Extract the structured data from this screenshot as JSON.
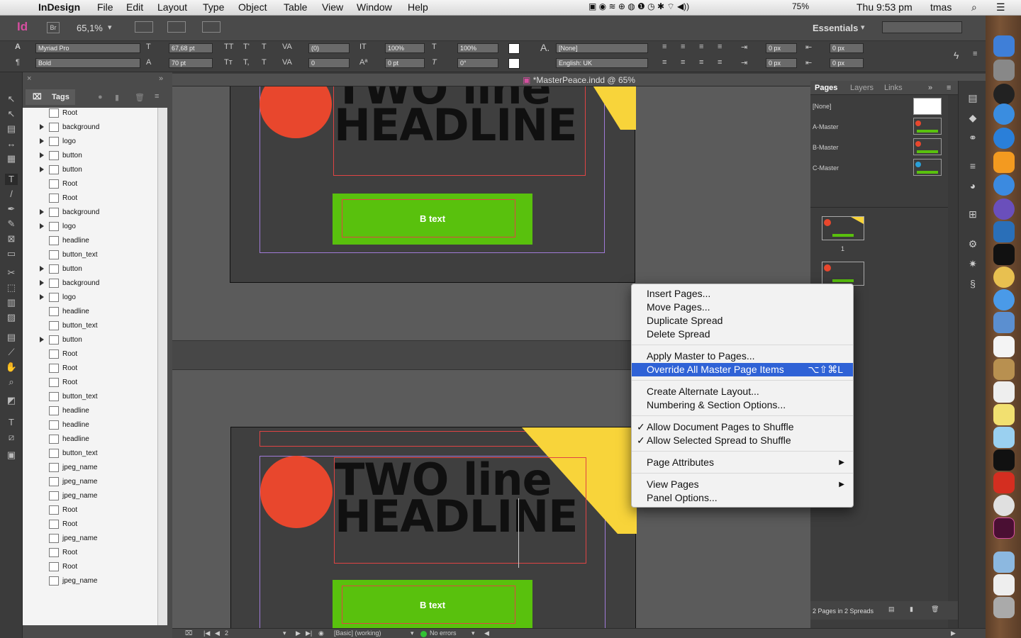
{
  "menubar": {
    "app": "InDesign",
    "items": [
      "File",
      "Edit",
      "Layout",
      "Type",
      "Object",
      "Table",
      "View",
      "Window",
      "Help"
    ],
    "battery": "75%",
    "clock": "Thu 9:53 pm",
    "user": "tmas"
  },
  "control": {
    "app_badge": "Id",
    "bridge": "Br",
    "zoom": "65,1%",
    "workspace": "Essentials",
    "font_family": "Myriad Pro",
    "font_style": "Bold",
    "font_size": "67,68 pt",
    "leading": "70 pt",
    "tracking": "(0)",
    "kerning": "0",
    "hscale": "100%",
    "vscale": "100%",
    "baseline": "0 pt",
    "skew": "0°",
    "char_style": "[None]",
    "language": "English: UK",
    "indent1": "0 px",
    "indent2": "0 px",
    "indent3": "0 px",
    "indent4": "0 px"
  },
  "document": {
    "title": "*MasterPeace.indd @ 65%"
  },
  "tags_panel": {
    "tab": "Tags",
    "items": [
      {
        "label": "Root",
        "expand": false
      },
      {
        "label": "background",
        "expand": true
      },
      {
        "label": "logo",
        "expand": true
      },
      {
        "label": "button",
        "expand": true
      },
      {
        "label": "button",
        "expand": true
      },
      {
        "label": "Root",
        "expand": false
      },
      {
        "label": "Root",
        "expand": false
      },
      {
        "label": "background",
        "expand": true
      },
      {
        "label": "logo",
        "expand": true
      },
      {
        "label": "headline",
        "expand": false
      },
      {
        "label": "button_text",
        "expand": false
      },
      {
        "label": "button",
        "expand": true
      },
      {
        "label": "background",
        "expand": true
      },
      {
        "label": "logo",
        "expand": true
      },
      {
        "label": "headline",
        "expand": false
      },
      {
        "label": "button_text",
        "expand": false
      },
      {
        "label": "button",
        "expand": true
      },
      {
        "label": "Root",
        "expand": false
      },
      {
        "label": "Root",
        "expand": false
      },
      {
        "label": "Root",
        "expand": false
      },
      {
        "label": "button_text",
        "expand": false
      },
      {
        "label": "headline",
        "expand": false
      },
      {
        "label": "headline",
        "expand": false
      },
      {
        "label": "headline",
        "expand": false
      },
      {
        "label": "button_text",
        "expand": false
      },
      {
        "label": "jpeg_name",
        "expand": false
      },
      {
        "label": "jpeg_name",
        "expand": false
      },
      {
        "label": "jpeg_name",
        "expand": false
      },
      {
        "label": "Root",
        "expand": false
      },
      {
        "label": "Root",
        "expand": false
      },
      {
        "label": "jpeg_name",
        "expand": false
      },
      {
        "label": "Root",
        "expand": false
      },
      {
        "label": "Root",
        "expand": false
      },
      {
        "label": "jpeg_name",
        "expand": false
      }
    ]
  },
  "artwork": {
    "line1": "TWO line",
    "line2": "HEADLINE",
    "button_text": "B text",
    "colors": {
      "red": "#e8472d",
      "yellow": "#f8d43a",
      "green": "#59c10d"
    }
  },
  "pages_panel": {
    "tabs": [
      "Pages",
      "Layers",
      "Links"
    ],
    "masters": [
      "[None]",
      "A-Master",
      "B-Master",
      "C-Master"
    ],
    "page_number": "1",
    "footer": "2 Pages in 2 Spreads"
  },
  "context_menu": {
    "groups": [
      [
        {
          "label": "Insert Pages..."
        },
        {
          "label": "Move Pages..."
        },
        {
          "label": "Duplicate Spread"
        },
        {
          "label": "Delete Spread"
        }
      ],
      [
        {
          "label": "Apply Master to Pages..."
        },
        {
          "label": "Override All Master Page Items",
          "shortcut": "⌥⇧⌘L",
          "highlight": true
        }
      ],
      [
        {
          "label": "Create Alternate Layout..."
        },
        {
          "label": "Numbering & Section Options..."
        }
      ],
      [
        {
          "label": "Allow Document Pages to Shuffle",
          "checked": true
        },
        {
          "label": "Allow Selected Spread to Shuffle",
          "checked": true
        }
      ],
      [
        {
          "label": "Page Attributes",
          "submenu": true
        }
      ],
      [
        {
          "label": "View Pages",
          "submenu": true
        },
        {
          "label": "Panel Options..."
        }
      ]
    ]
  },
  "status": {
    "page": "2",
    "preflight_profile": "[Basic] (working)",
    "errors": "No errors"
  }
}
